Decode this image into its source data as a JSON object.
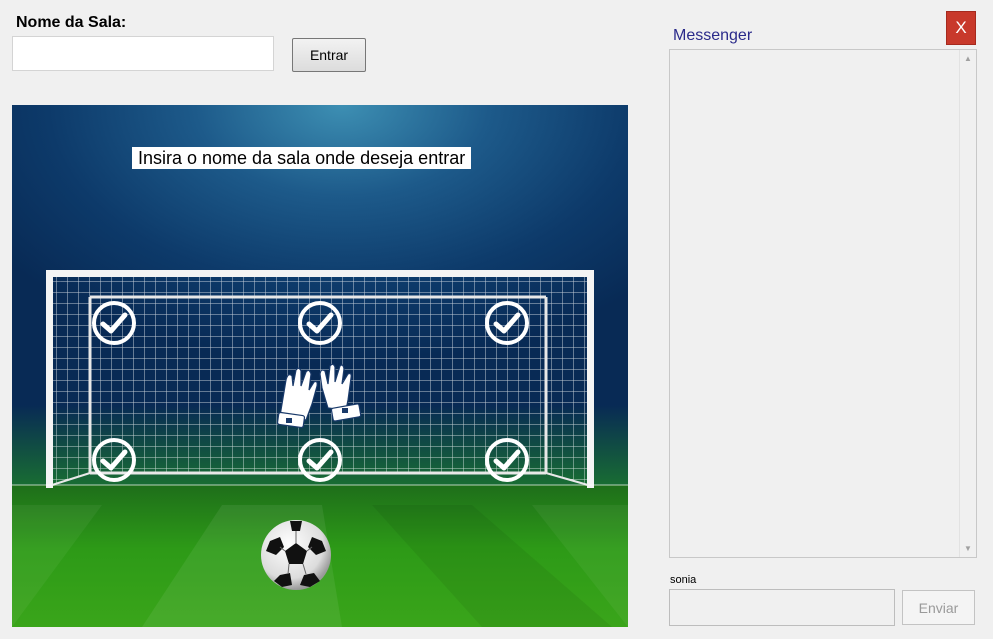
{
  "room": {
    "label": "Nome da Sala:",
    "input_value": "",
    "enter_label": "Entrar"
  },
  "game": {
    "instruction": "Insira o nome da sala onde deseja entrar",
    "targets": [
      "check-target",
      "check-target",
      "check-target",
      "check-target",
      "check-target",
      "check-target"
    ]
  },
  "messenger": {
    "title": "Messenger",
    "close_label": "X",
    "scroll_up": "▲",
    "scroll_down": "▼",
    "username": "sonia",
    "message_value": "",
    "send_label": "Enviar"
  },
  "colors": {
    "close_bg": "#c8392b",
    "messenger_title": "#2a2a8a",
    "sky": "#0d3a6a",
    "grass": "#2d9a17"
  }
}
